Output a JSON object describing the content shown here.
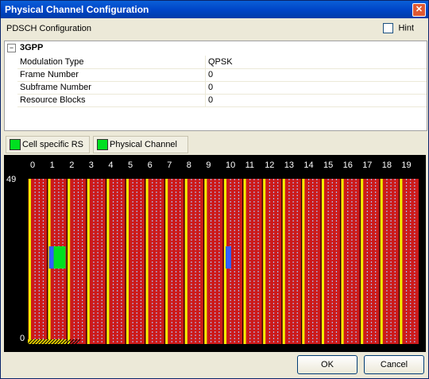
{
  "window": {
    "title": "Physical Channel Configuration",
    "close_glyph": "✕"
  },
  "header": {
    "label": "PDSCH Configuration",
    "hint_label": "Hint",
    "hint_checked": false
  },
  "properties": {
    "category": "3GPP",
    "toggle": "−",
    "rows": [
      {
        "name": "Modulation Type",
        "value": "QPSK"
      },
      {
        "name": "Frame Number",
        "value": "0"
      },
      {
        "name": "Subframe Number",
        "value": "0"
      },
      {
        "name": "Resource Blocks",
        "value": "0"
      }
    ]
  },
  "legend": [
    {
      "label": "Cell specific RS",
      "color": "#00e020"
    },
    {
      "label": "Physical Channel",
      "color": "#00e020"
    }
  ],
  "chart_data": {
    "type": "heatmap",
    "x_tick_labels": [
      "0",
      "1",
      "2",
      "3",
      "4",
      "5",
      "6",
      "7",
      "8",
      "9",
      "10",
      "11",
      "12",
      "13",
      "14",
      "15",
      "16",
      "17",
      "18",
      "19"
    ],
    "y_tick_labels": [
      "49",
      "0"
    ],
    "colors": {
      "background": "#cc1a1a",
      "control": "#f2f200",
      "reference": "#b0b0e0",
      "pbch": "#3060ff",
      "physical_channel": "#00e020",
      "bottom_hatch": "#e8d000"
    }
  },
  "buttons": {
    "ok": "OK",
    "cancel": "Cancel"
  }
}
